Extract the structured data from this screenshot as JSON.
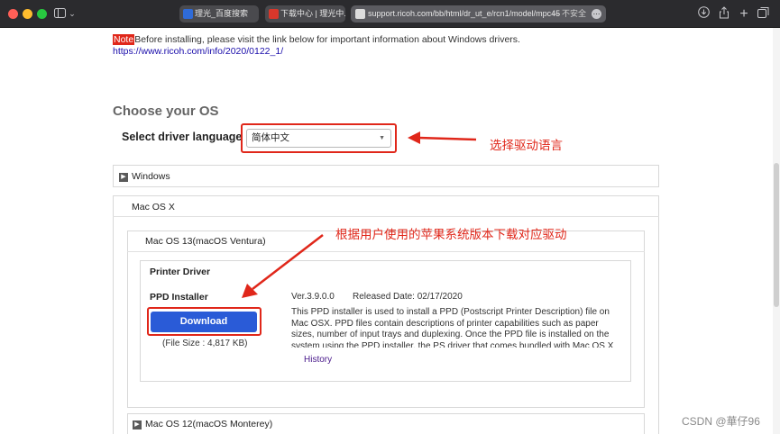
{
  "browser": {
    "tabs": [
      {
        "label": "理光_百度搜索",
        "favicon_color": "#2f6bd8"
      },
      {
        "label": "下载中心 | 理光中...",
        "favicon_color": "#d8372b"
      }
    ],
    "url": "support.ricoh.com/bb/html/dr_ut_e/rcn1/model/mpc45",
    "security_text": "— 不安全",
    "icons": [
      "sidebar-icon",
      "chevron-down-icon",
      "download-icon",
      "share-icon",
      "new-tab-icon",
      "tab-overview-icon"
    ]
  },
  "page": {
    "note_tag": "Note",
    "note_text": "Before installing, please visit the link below for important information about Windows drivers.",
    "note_link": "https://www.ricoh.com/info/2020/0122_1/",
    "choose_os": "Choose your OS",
    "driver_language_label": "Select driver language",
    "driver_language_value": "简体中文",
    "windows_label": "Windows",
    "mac_label": "Mac OS X",
    "ventura_label": "Mac OS 13(macOS Ventura)",
    "printer_driver_label": "Printer Driver",
    "ppd_label": "PPD Installer",
    "download_label": "Download",
    "file_size": "(File Size : 4,817 KB)",
    "version": "Ver.3.9.0.0",
    "release_date": "Released Date: 02/17/2020",
    "description": "This PPD installer is used to install a PPD (Postscript Printer Description) file on Mac OSX. PPD files contain descriptions of printer capabilities such as paper sizes, number of input trays and duplexing. Once the PPD file is installed on the system using the PPD installer, the PS driver that comes bundled with Mac OS X can use the",
    "history_label": "History",
    "monterey_label": "Mac OS 12(macOS Monterey)"
  },
  "annotations": {
    "language_note": "选择驱动语言",
    "version_note": "根据用户使用的苹果系统版本下载对应驱动",
    "accent_color": "#e0271a"
  },
  "watermark": "CSDN @華仔96"
}
